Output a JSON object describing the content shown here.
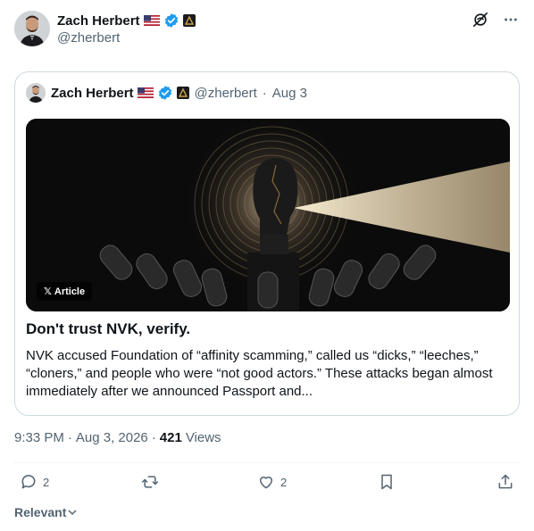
{
  "author": {
    "name": "Zach Herbert",
    "handle": "@zherbert",
    "icons": [
      "us-flag-icon",
      "verified-badge-icon",
      "affiliation-badge-icon"
    ]
  },
  "top_actions": [
    "grok-icon",
    "more-icon"
  ],
  "quoted_post": {
    "name": "Zach Herbert",
    "handle": "@zherbert",
    "separator": "·",
    "date": "Aug 3",
    "article_tag": "Article",
    "article_title": "Don't trust NVK, verify.",
    "article_body": "NVK accused Foundation of “affinity scamming,” called us “dicks,” “leeches,” “cloners,” and people who were “not good actors.” These attacks began almost immediately after we announced Passport and..."
  },
  "meta": {
    "time": "9:33 PM",
    "separator": "·",
    "date": "Aug 3, 2026",
    "separator2": "·",
    "views": "421",
    "views_label": "Views"
  },
  "actions": {
    "replies": "2",
    "reposts": "",
    "likes": "2"
  },
  "sort": {
    "label": "Relevant"
  },
  "colors": {
    "text": "#0f1419",
    "muted": "#536471",
    "verified": "#1d9bf0",
    "border": "#cfd9de"
  }
}
